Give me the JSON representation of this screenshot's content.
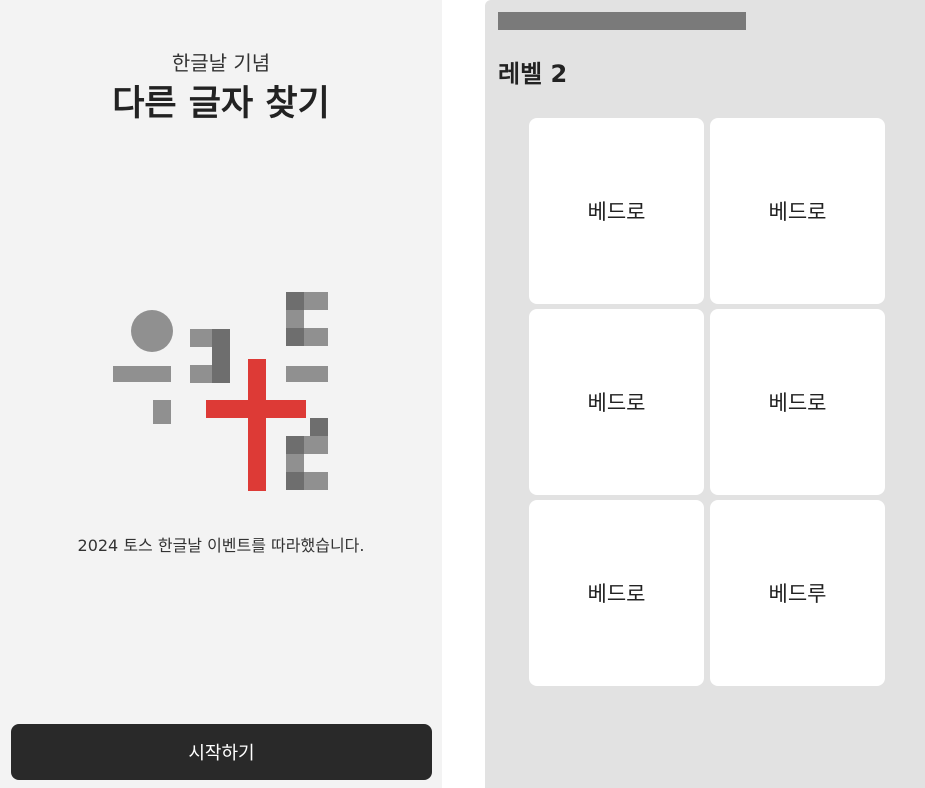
{
  "intro": {
    "subtitle": "한글날 기념",
    "title": "다른 글자 찾기",
    "description": "2024 토스 한글날 이벤트를 따라했습니다.",
    "start_label": "시작하기",
    "logo_accent_color": "#dd3a36"
  },
  "game": {
    "level_label": "레벨 2",
    "progress": 0.62,
    "cards": [
      {
        "text": "베드로"
      },
      {
        "text": "베드로"
      },
      {
        "text": "베드로"
      },
      {
        "text": "베드로"
      },
      {
        "text": "베드로"
      },
      {
        "text": "베드루"
      }
    ]
  }
}
